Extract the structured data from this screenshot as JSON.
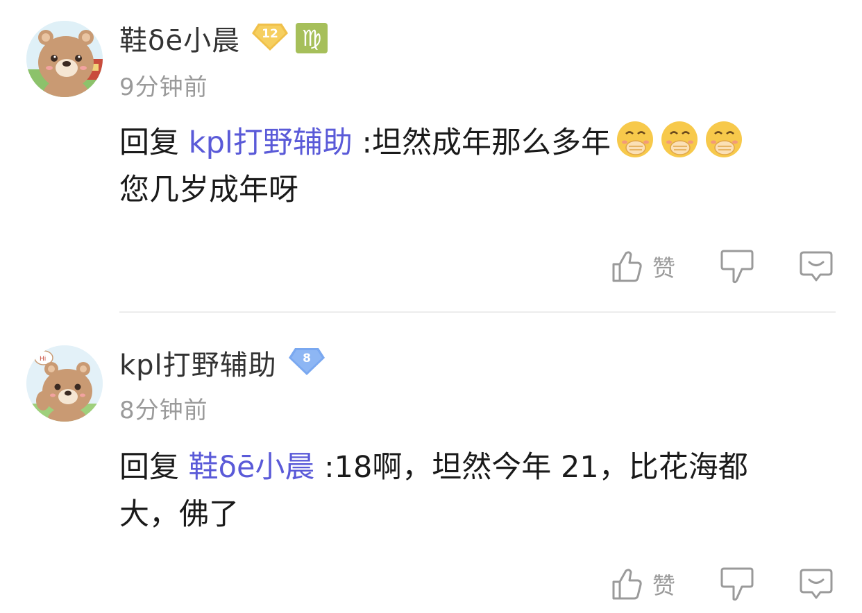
{
  "comments": [
    {
      "username": "鞋δē小晨",
      "level": "12",
      "zodiac": "♍",
      "time": "9分钟前",
      "reply_prefix": "回复",
      "mention": "kpl打野辅助",
      "text_line1": ":坦然成年那么多年",
      "text_line2": "您几岁成年呀",
      "like_label": "赞"
    },
    {
      "username": "kpl打野辅助",
      "level": "8",
      "time": "8分钟前",
      "reply_prefix": "回复",
      "mention": "鞋δē小晨",
      "text_line1": ":18啊，坦然今年 21，比花海都",
      "text_line2": "大，佛了",
      "like_label": "赞"
    }
  ],
  "colors": {
    "mention": "#5a5ad8",
    "level_gold": "#f0c04a",
    "level_blue": "#7aa8f0",
    "zodiac_green": "#a6bf5a",
    "muted_text": "#9a9a9a"
  },
  "icons": [
    "bear-avatar",
    "bear-avatar-hi",
    "level-badge-icon",
    "virgo-zodiac-icon",
    "cover-mouth-emoji",
    "thumbs-up-icon",
    "thumbs-down-icon",
    "reply-bubble-icon"
  ]
}
